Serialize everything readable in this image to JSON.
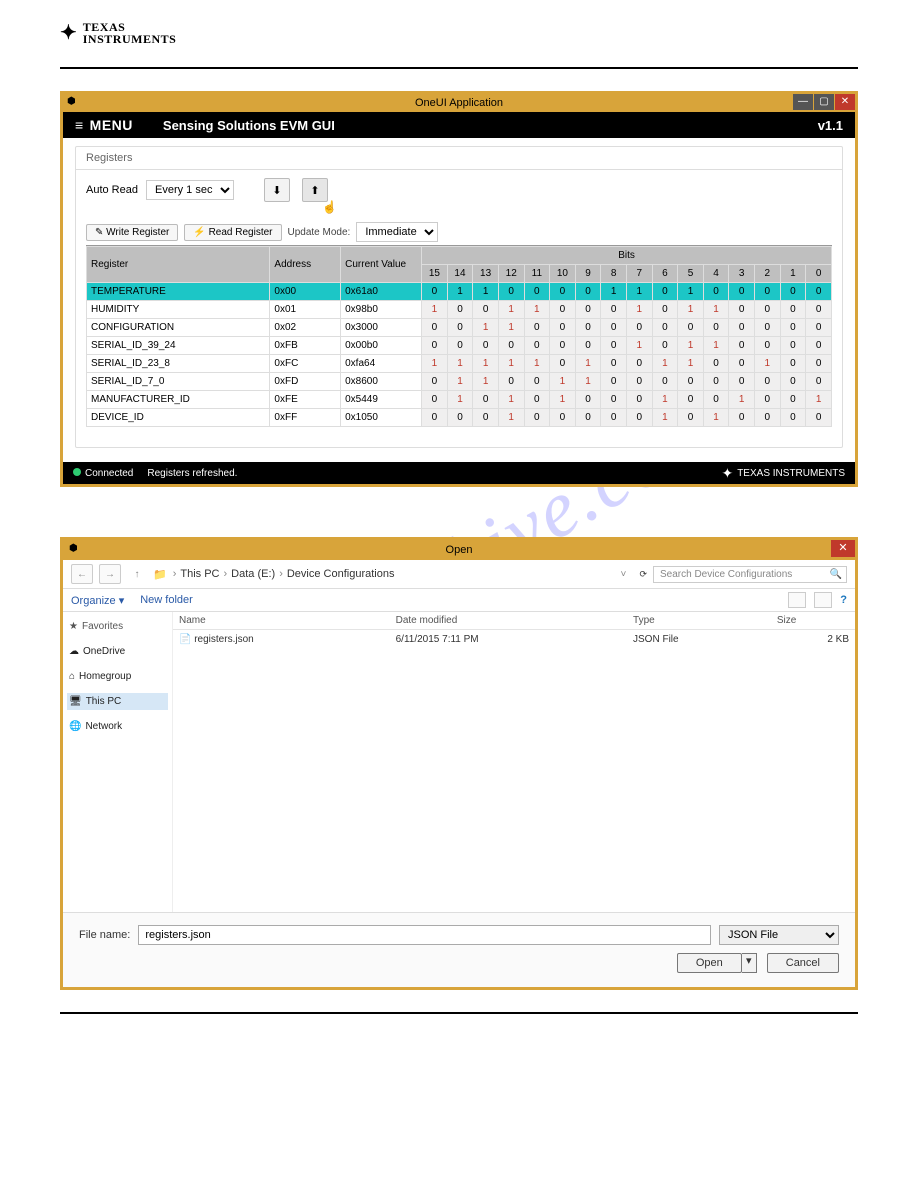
{
  "logo": {
    "line1": "TEXAS",
    "line2": "INSTRUMENTS"
  },
  "watermark": "manualshive.com",
  "app": {
    "window_title": "OneUI Application",
    "menu_label": "MENU",
    "subtitle": "Sensing Solutions EVM GUI",
    "version": "v1.1",
    "panel_title": "Registers",
    "auto_read_label": "Auto Read",
    "auto_read_value": "Every 1 sec",
    "write_btn": "Write Register",
    "read_btn": "Read Register",
    "update_mode_label": "Update Mode:",
    "update_mode_value": "Immediate",
    "table": {
      "headers": {
        "register": "Register",
        "address": "Address",
        "current": "Current Value",
        "bits": "Bits"
      },
      "bit_cols": [
        "15",
        "14",
        "13",
        "12",
        "11",
        "10",
        "9",
        "8",
        "7",
        "6",
        "5",
        "4",
        "3",
        "2",
        "1",
        "0"
      ],
      "rows": [
        {
          "name": "TEMPERATURE",
          "addr": "0x00",
          "val": "0x61a0",
          "bits": [
            "0",
            "1",
            "1",
            "0",
            "0",
            "0",
            "0",
            "1",
            "1",
            "0",
            "1",
            "0",
            "0",
            "0",
            "0",
            "0"
          ],
          "selected": true
        },
        {
          "name": "HUMIDITY",
          "addr": "0x01",
          "val": "0x98b0",
          "bits": [
            "1",
            "0",
            "0",
            "1",
            "1",
            "0",
            "0",
            "0",
            "1",
            "0",
            "1",
            "1",
            "0",
            "0",
            "0",
            "0"
          ]
        },
        {
          "name": "CONFIGURATION",
          "addr": "0x02",
          "val": "0x3000",
          "bits": [
            "0",
            "0",
            "1",
            "1",
            "0",
            "0",
            "0",
            "0",
            "0",
            "0",
            "0",
            "0",
            "0",
            "0",
            "0",
            "0"
          ]
        },
        {
          "name": "SERIAL_ID_39_24",
          "addr": "0xFB",
          "val": "0x00b0",
          "bits": [
            "0",
            "0",
            "0",
            "0",
            "0",
            "0",
            "0",
            "0",
            "1",
            "0",
            "1",
            "1",
            "0",
            "0",
            "0",
            "0"
          ]
        },
        {
          "name": "SERIAL_ID_23_8",
          "addr": "0xFC",
          "val": "0xfa64",
          "bits": [
            "1",
            "1",
            "1",
            "1",
            "1",
            "0",
            "1",
            "0",
            "0",
            "1",
            "1",
            "0",
            "0",
            "1",
            "0",
            "0"
          ]
        },
        {
          "name": "SERIAL_ID_7_0",
          "addr": "0xFD",
          "val": "0x8600",
          "bits": [
            "0",
            "1",
            "1",
            "0",
            "0",
            "1",
            "1",
            "0",
            "0",
            "0",
            "0",
            "0",
            "0",
            "0",
            "0",
            "0"
          ]
        },
        {
          "name": "MANUFACTURER_ID",
          "addr": "0xFE",
          "val": "0x5449",
          "bits": [
            "0",
            "1",
            "0",
            "1",
            "0",
            "1",
            "0",
            "0",
            "0",
            "1",
            "0",
            "0",
            "1",
            "0",
            "0",
            "1"
          ]
        },
        {
          "name": "DEVICE_ID",
          "addr": "0xFF",
          "val": "0x1050",
          "bits": [
            "0",
            "0",
            "0",
            "1",
            "0",
            "0",
            "0",
            "0",
            "0",
            "1",
            "0",
            "1",
            "0",
            "0",
            "0",
            "0"
          ]
        }
      ]
    },
    "status": {
      "connected": "Connected",
      "msg": "Registers refreshed.",
      "brand": "TEXAS INSTRUMENTS"
    }
  },
  "dialog": {
    "title": "Open",
    "breadcrumbs": [
      "This PC",
      "Data (E:)",
      "Device Configurations"
    ],
    "search_placeholder": "Search Device Configurations",
    "organize": "Organize",
    "new_folder": "New folder",
    "tree": [
      {
        "icon": "★",
        "label": "Favorites",
        "hdr": true
      },
      {
        "icon": "☁",
        "label": "OneDrive"
      },
      {
        "icon": "⌂",
        "label": "Homegroup"
      },
      {
        "icon": "🖥",
        "label": "This PC",
        "selected": true
      },
      {
        "icon": "🌐",
        "label": "Network"
      }
    ],
    "columns": [
      "Name",
      "Date modified",
      "Type",
      "Size"
    ],
    "files": [
      {
        "name": "registers.json",
        "date": "6/11/2015 7:11 PM",
        "type": "JSON File",
        "size": "2 KB"
      }
    ],
    "filename_label": "File name:",
    "filename_value": "registers.json",
    "filter_value": "JSON File",
    "open_btn": "Open",
    "cancel_btn": "Cancel"
  }
}
